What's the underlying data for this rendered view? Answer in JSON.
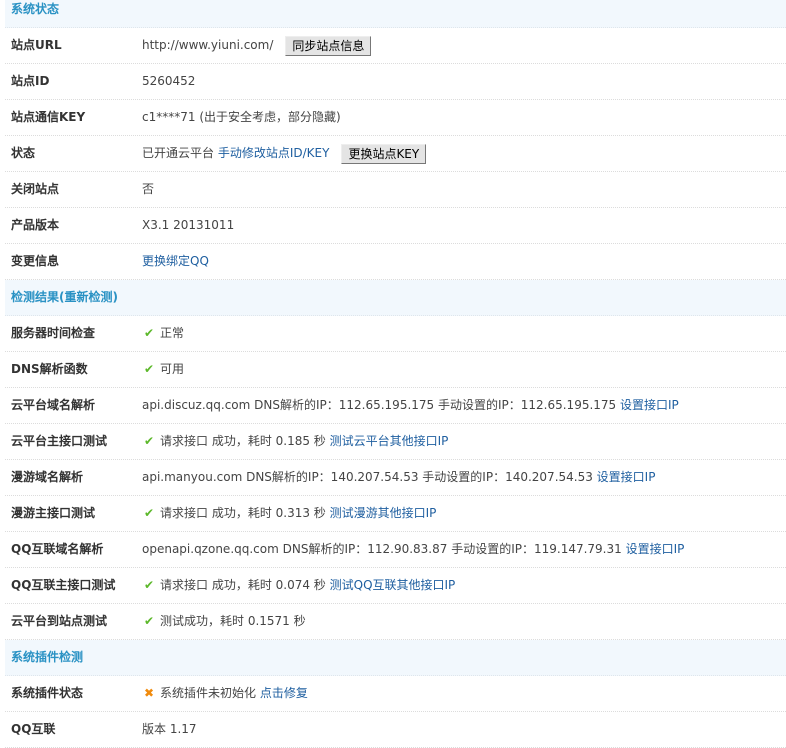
{
  "colors": {
    "header_text": "#2a92c4",
    "link": "#1f5fa0",
    "ok": "#5cb82a",
    "error": "#f08a0c"
  },
  "sections": [
    {
      "title": "系统状态",
      "rows": [
        {
          "label": "站点URL",
          "parts": [
            {
              "t": "text",
              "v": "http://www.yiuni.com/"
            },
            {
              "t": "button",
              "v": "同步站点信息"
            }
          ]
        },
        {
          "label": "站点ID",
          "parts": [
            {
              "t": "text",
              "v": "5260452"
            }
          ]
        },
        {
          "label": "站点通信KEY",
          "parts": [
            {
              "t": "text",
              "v": "c1****71 (出于安全考虑，部分隐藏)"
            }
          ]
        },
        {
          "label": "状态",
          "parts": [
            {
              "t": "text",
              "v": "已开通云平台 "
            },
            {
              "t": "link",
              "v": "手动修改站点ID/KEY"
            },
            {
              "t": "button",
              "v": "更换站点KEY"
            }
          ]
        },
        {
          "label": "关闭站点",
          "parts": [
            {
              "t": "text",
              "v": "否"
            }
          ]
        },
        {
          "label": "产品版本",
          "parts": [
            {
              "t": "text",
              "v": "X3.1 20131011"
            }
          ]
        },
        {
          "label": "变更信息",
          "parts": [
            {
              "t": "link",
              "v": "更换绑定QQ"
            }
          ]
        }
      ]
    },
    {
      "title": "检测结果(重新检测)",
      "rows": [
        {
          "label": "服务器时间检查",
          "parts": [
            {
              "t": "check"
            },
            {
              "t": "text",
              "v": "正常"
            }
          ]
        },
        {
          "label": "DNS解析函数",
          "parts": [
            {
              "t": "check"
            },
            {
              "t": "text",
              "v": "可用"
            }
          ]
        },
        {
          "label": "云平台域名解析",
          "parts": [
            {
              "t": "text",
              "v": "api.discuz.qq.com DNS解析的IP：112.65.195.175 手动设置的IP：112.65.195.175 "
            },
            {
              "t": "link",
              "v": "设置接口IP"
            }
          ]
        },
        {
          "label": "云平台主接口测试",
          "parts": [
            {
              "t": "check"
            },
            {
              "t": "text",
              "v": "请求接口 成功，耗时 0.185 秒 "
            },
            {
              "t": "link",
              "v": "测试云平台其他接口IP"
            }
          ]
        },
        {
          "label": "漫游域名解析",
          "parts": [
            {
              "t": "text",
              "v": "api.manyou.com DNS解析的IP：140.207.54.53 手动设置的IP：140.207.54.53 "
            },
            {
              "t": "link",
              "v": "设置接口IP"
            }
          ]
        },
        {
          "label": "漫游主接口测试",
          "parts": [
            {
              "t": "check"
            },
            {
              "t": "text",
              "v": "请求接口 成功，耗时 0.313 秒 "
            },
            {
              "t": "link",
              "v": "测试漫游其他接口IP"
            }
          ]
        },
        {
          "label": "QQ互联域名解析",
          "parts": [
            {
              "t": "text",
              "v": "openapi.qzone.qq.com DNS解析的IP：112.90.83.87 手动设置的IP：119.147.79.31 "
            },
            {
              "t": "link",
              "v": "设置接口IP"
            }
          ]
        },
        {
          "label": "QQ互联主接口测试",
          "parts": [
            {
              "t": "check"
            },
            {
              "t": "text",
              "v": "请求接口 成功，耗时 0.074 秒 "
            },
            {
              "t": "link",
              "v": "测试QQ互联其他接口IP"
            }
          ]
        },
        {
          "label": "云平台到站点测试",
          "parts": [
            {
              "t": "check"
            },
            {
              "t": "text",
              "v": "测试成功，耗时 0.1571 秒"
            }
          ]
        }
      ]
    },
    {
      "title": "系统插件检测",
      "rows": [
        {
          "label": "系统插件状态",
          "parts": [
            {
              "t": "cross"
            },
            {
              "t": "text",
              "v": "系统插件未初始化 "
            },
            {
              "t": "link",
              "v": "点击修复"
            }
          ]
        },
        {
          "label": "QQ互联",
          "parts": [
            {
              "t": "text",
              "v": "版本 1.17"
            }
          ]
        }
      ]
    }
  ]
}
